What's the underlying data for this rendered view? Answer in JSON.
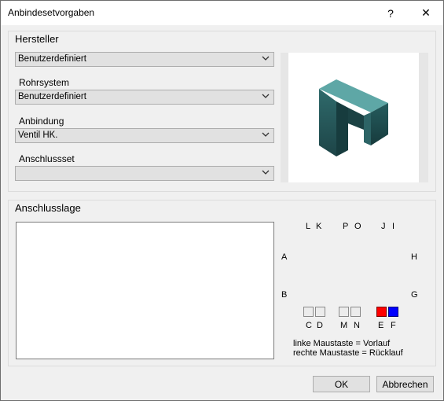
{
  "window": {
    "title": "Anbindesetvorgaben",
    "help_label": "?",
    "close_label": "✕"
  },
  "hersteller": {
    "group_title": "Hersteller",
    "hersteller_value": "Benutzerdefiniert",
    "rohrsystem_label": "Rohrsystem",
    "rohrsystem_value": "Benutzerdefiniert",
    "anbindung_label": "Anbindung",
    "anbindung_value": "Ventil HK.",
    "anschlussset_label": "Anschlussset",
    "anschlussset_value": ""
  },
  "anschlusslage": {
    "group_title": "Anschlusslage",
    "top_letters": [
      "L",
      "K",
      "P",
      "O",
      "J",
      "I"
    ],
    "left_letters": [
      "A",
      "B"
    ],
    "right_letters": [
      "H",
      "G"
    ],
    "bottom_letters": [
      "C",
      "D",
      "M",
      "N",
      "E",
      "F"
    ],
    "hint_left": "linke Maustaste = Vorlauf",
    "hint_right": "rechte Maustaste = Rücklauf",
    "colors": {
      "vorlauf": "#ff0000",
      "ruecklauf": "#0000ff"
    }
  },
  "buttons": {
    "ok": "OK",
    "cancel": "Abbrechen"
  }
}
